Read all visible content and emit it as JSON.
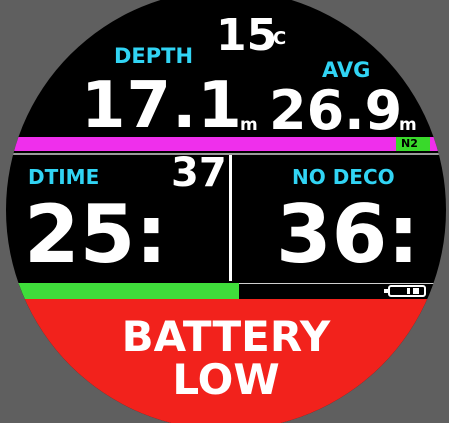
{
  "temperature": {
    "value": "15",
    "unit": "°C"
  },
  "depth": {
    "label": "DEPTH",
    "value": "17.1",
    "unit": "m"
  },
  "avg_depth": {
    "label": "AVG",
    "value": "26.9",
    "unit": "m"
  },
  "gas": {
    "label": "N2",
    "bar_color": "#ef2fec",
    "badge_color": "#39d92b"
  },
  "dive_time": {
    "label": "DTIME",
    "minutes": "25:",
    "seconds": "37"
  },
  "no_deco": {
    "label": "NO DECO",
    "value": "36:"
  },
  "progress": {
    "fill_fraction": 0.53,
    "fill_color": "#3fdc3b"
  },
  "battery_icon": "battery-low-icon",
  "alarm": {
    "line1": "BATTERY",
    "line2": "LOW",
    "bg_color": "#f2221c"
  },
  "accent_color": "#31d4f4"
}
